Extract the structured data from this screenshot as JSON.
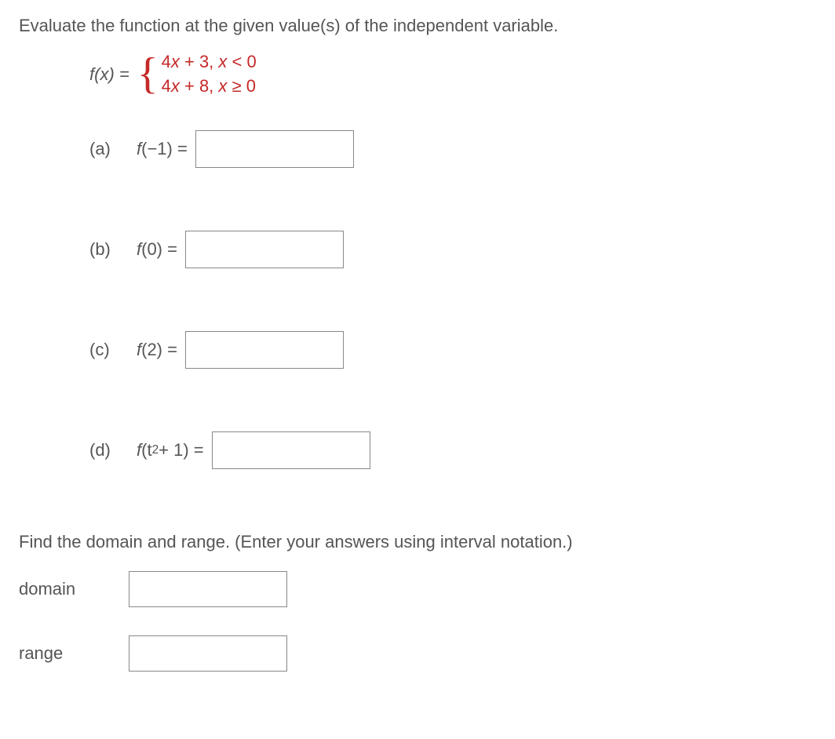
{
  "instruction": "Evaluate the function at the given value(s) of the independent variable.",
  "function": {
    "lhs": "f(x) =",
    "piece1_expr": "4x + 3,",
    "piece1_cond": "x < 0",
    "piece2_expr": "4x + 8,",
    "piece2_cond": "x ≥ 0"
  },
  "parts": {
    "a": {
      "label": "(a)",
      "expr_pre": "f",
      "expr_arg": "(−1) ="
    },
    "b": {
      "label": "(b)",
      "expr_pre": "f",
      "expr_arg": "(0) ="
    },
    "c": {
      "label": "(c)",
      "expr_pre": "f",
      "expr_arg": "(2) ="
    },
    "d": {
      "label": "(d)",
      "expr_pre": "f",
      "expr_arg_open": "(t",
      "expr_arg_sup": "2",
      "expr_arg_close": " + 1) ="
    }
  },
  "section2": "Find the domain and range. (Enter your answers using interval notation.)",
  "domain_label": "domain",
  "range_label": "range"
}
